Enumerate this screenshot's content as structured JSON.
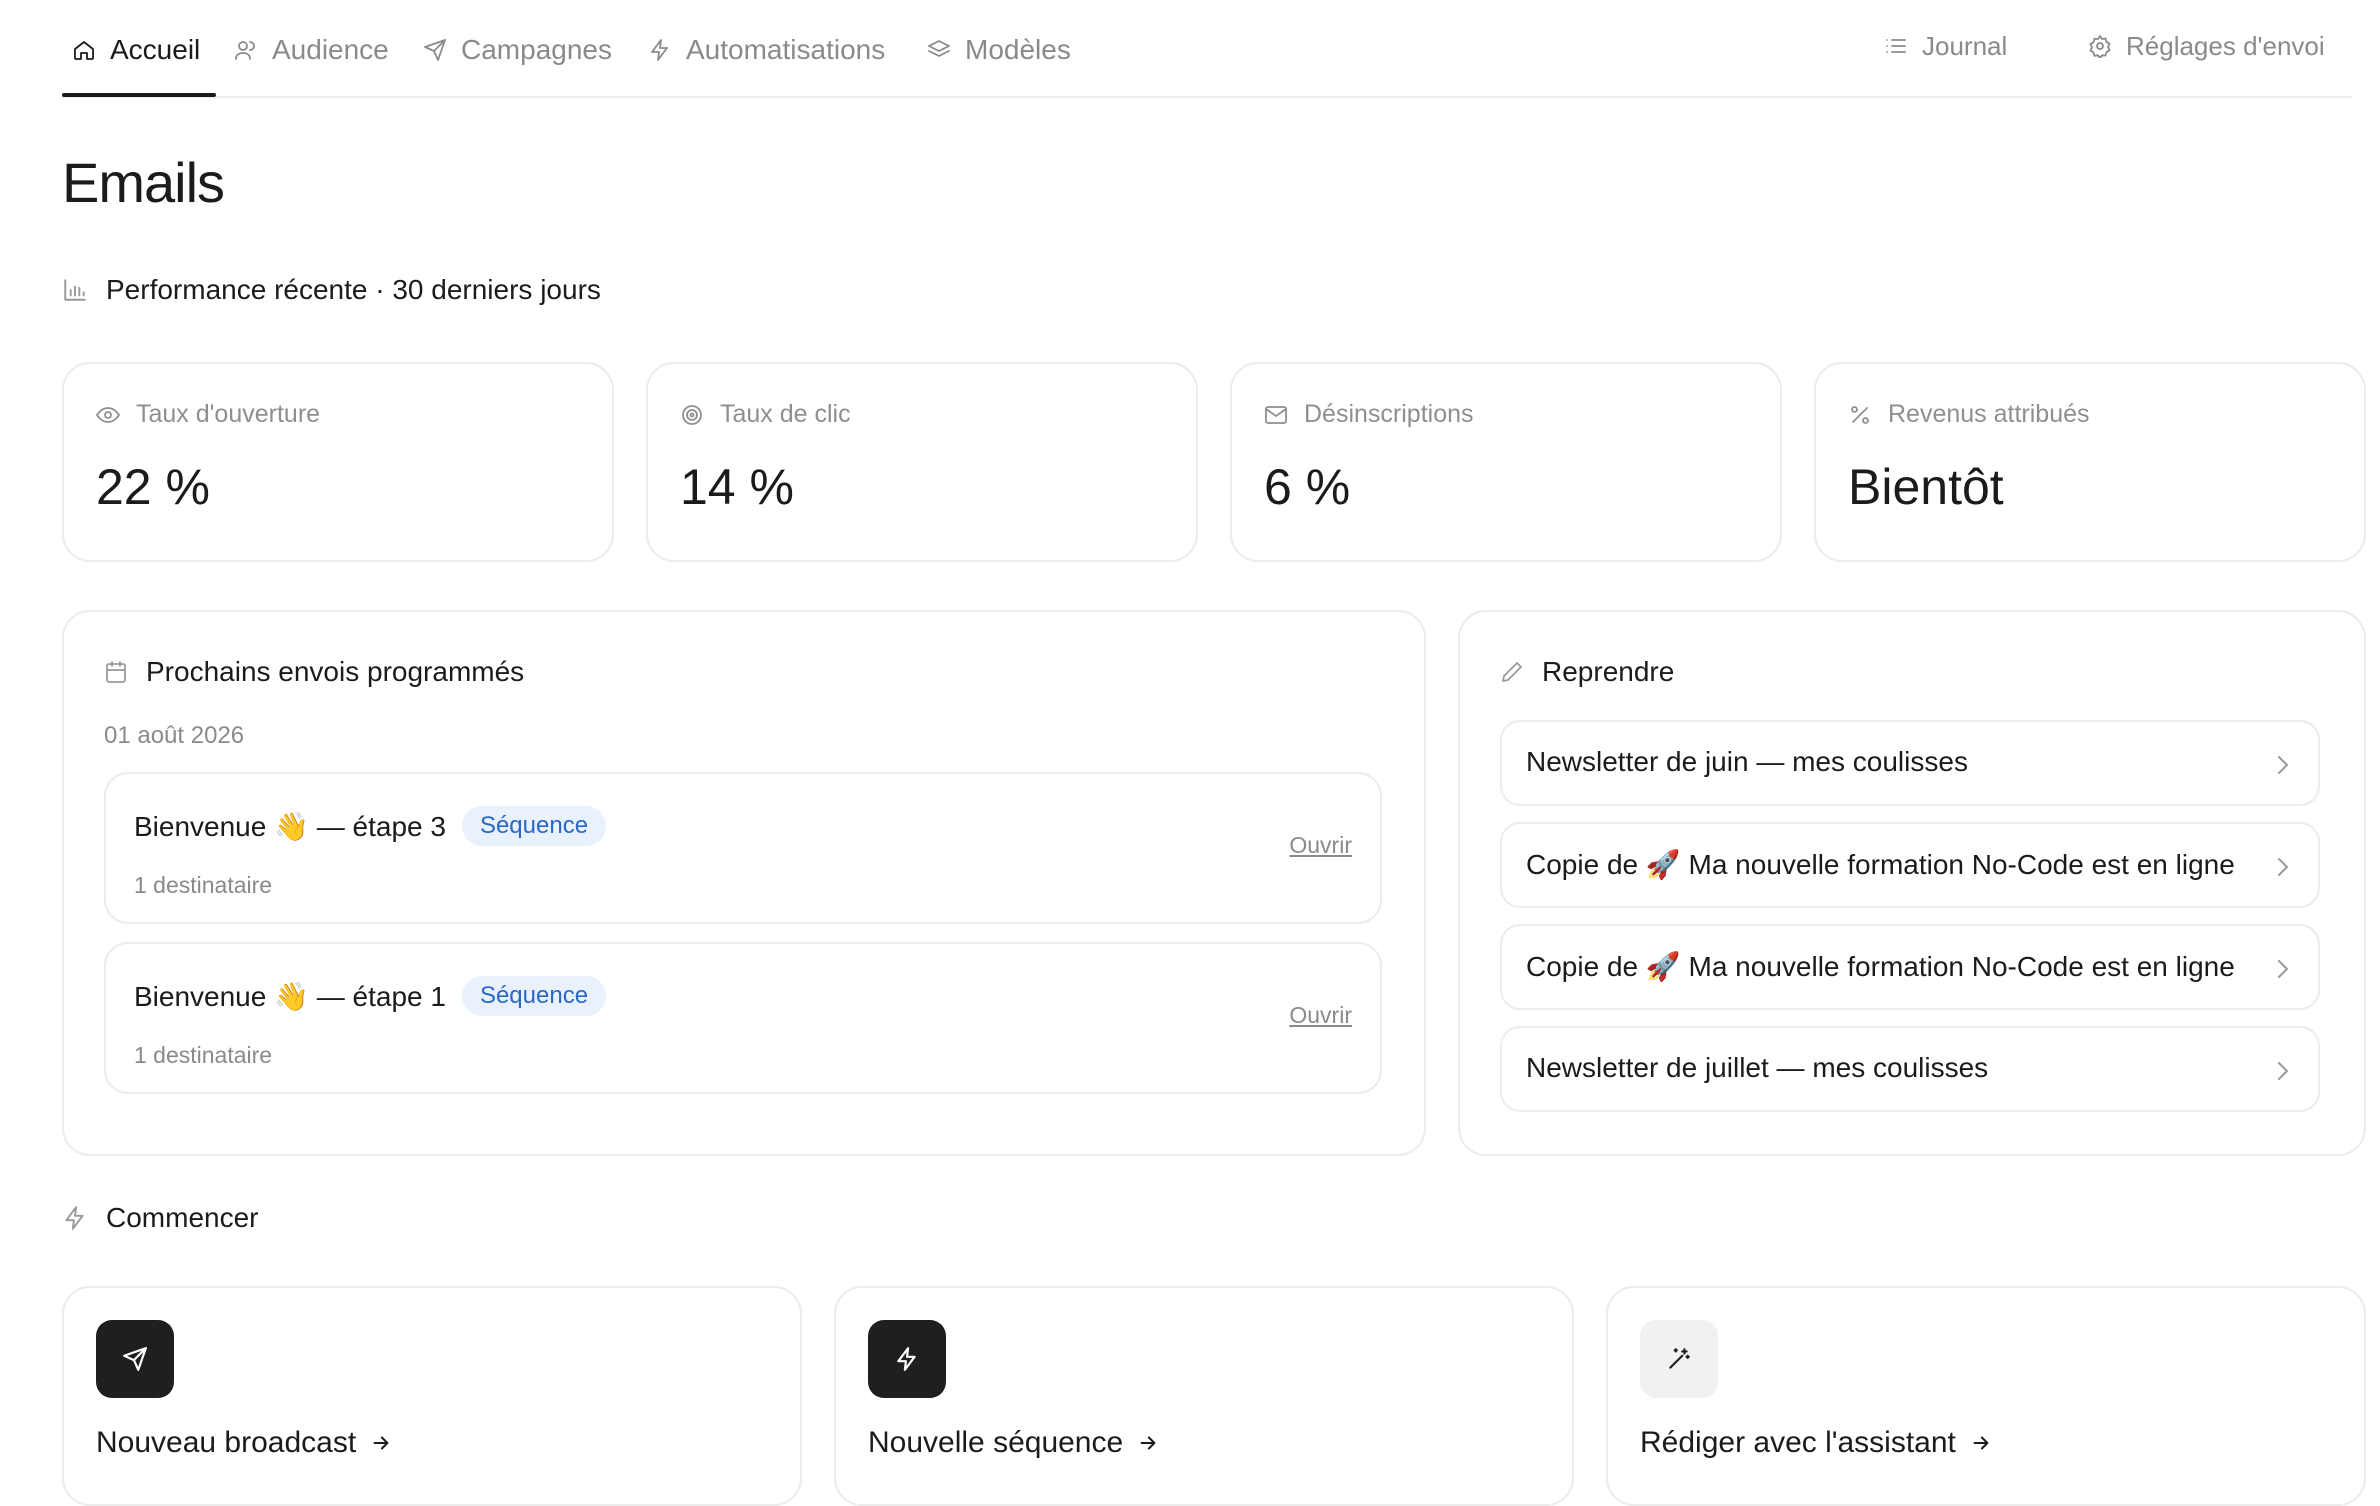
{
  "nav": {
    "tabs": [
      {
        "label": "Accueil",
        "icon": "home-icon",
        "active": true
      },
      {
        "label": "Audience",
        "icon": "users-icon",
        "active": false
      },
      {
        "label": "Campagnes",
        "icon": "send-icon",
        "active": false
      },
      {
        "label": "Automatisations",
        "icon": "bolt-icon",
        "active": false
      },
      {
        "label": "Modèles",
        "icon": "layers-icon",
        "active": false
      }
    ],
    "right": [
      {
        "label": "Journal",
        "icon": "list-icon"
      },
      {
        "label": "Réglages d'envoi",
        "icon": "gear-icon"
      }
    ]
  },
  "page": {
    "title": "Emails"
  },
  "performance": {
    "heading": "Performance récente · 30 derniers jours",
    "metrics": [
      {
        "label": "Taux d'ouverture",
        "value": "22 %",
        "icon": "eye-icon"
      },
      {
        "label": "Taux de clic",
        "value": "14 %",
        "icon": "target-icon"
      },
      {
        "label": "Désinscriptions",
        "value": "6 %",
        "icon": "mail-icon"
      },
      {
        "label": "Revenus attribués",
        "value": "Bientôt",
        "icon": "percent-icon"
      }
    ]
  },
  "scheduled": {
    "heading": "Prochains envois programmés",
    "date": "01 août 2026",
    "items": [
      {
        "name": "Bienvenue 👋 — étape 3",
        "badge": "Séquence",
        "meta": "1 destinataire",
        "action": "Ouvrir"
      },
      {
        "name": "Bienvenue 👋 — étape 1",
        "badge": "Séquence",
        "meta": "1 destinataire",
        "action": "Ouvrir"
      }
    ]
  },
  "resume": {
    "heading": "Reprendre",
    "items": [
      {
        "label": "Newsletter de juin — mes coulisses"
      },
      {
        "label": "Copie de 🚀 Ma nouvelle formation No-Code est en ligne"
      },
      {
        "label": "Copie de 🚀 Ma nouvelle formation No-Code est en ligne"
      },
      {
        "label": "Newsletter de juillet — mes coulisses"
      }
    ]
  },
  "start": {
    "heading": "Commencer",
    "cards": [
      {
        "label": "Nouveau broadcast",
        "icon": "send-icon",
        "style": "dark"
      },
      {
        "label": "Nouvelle séquence",
        "icon": "bolt-icon",
        "style": "dark"
      },
      {
        "label": "Rédiger avec l'assistant",
        "icon": "magic-wand-icon",
        "style": "light"
      }
    ]
  }
}
